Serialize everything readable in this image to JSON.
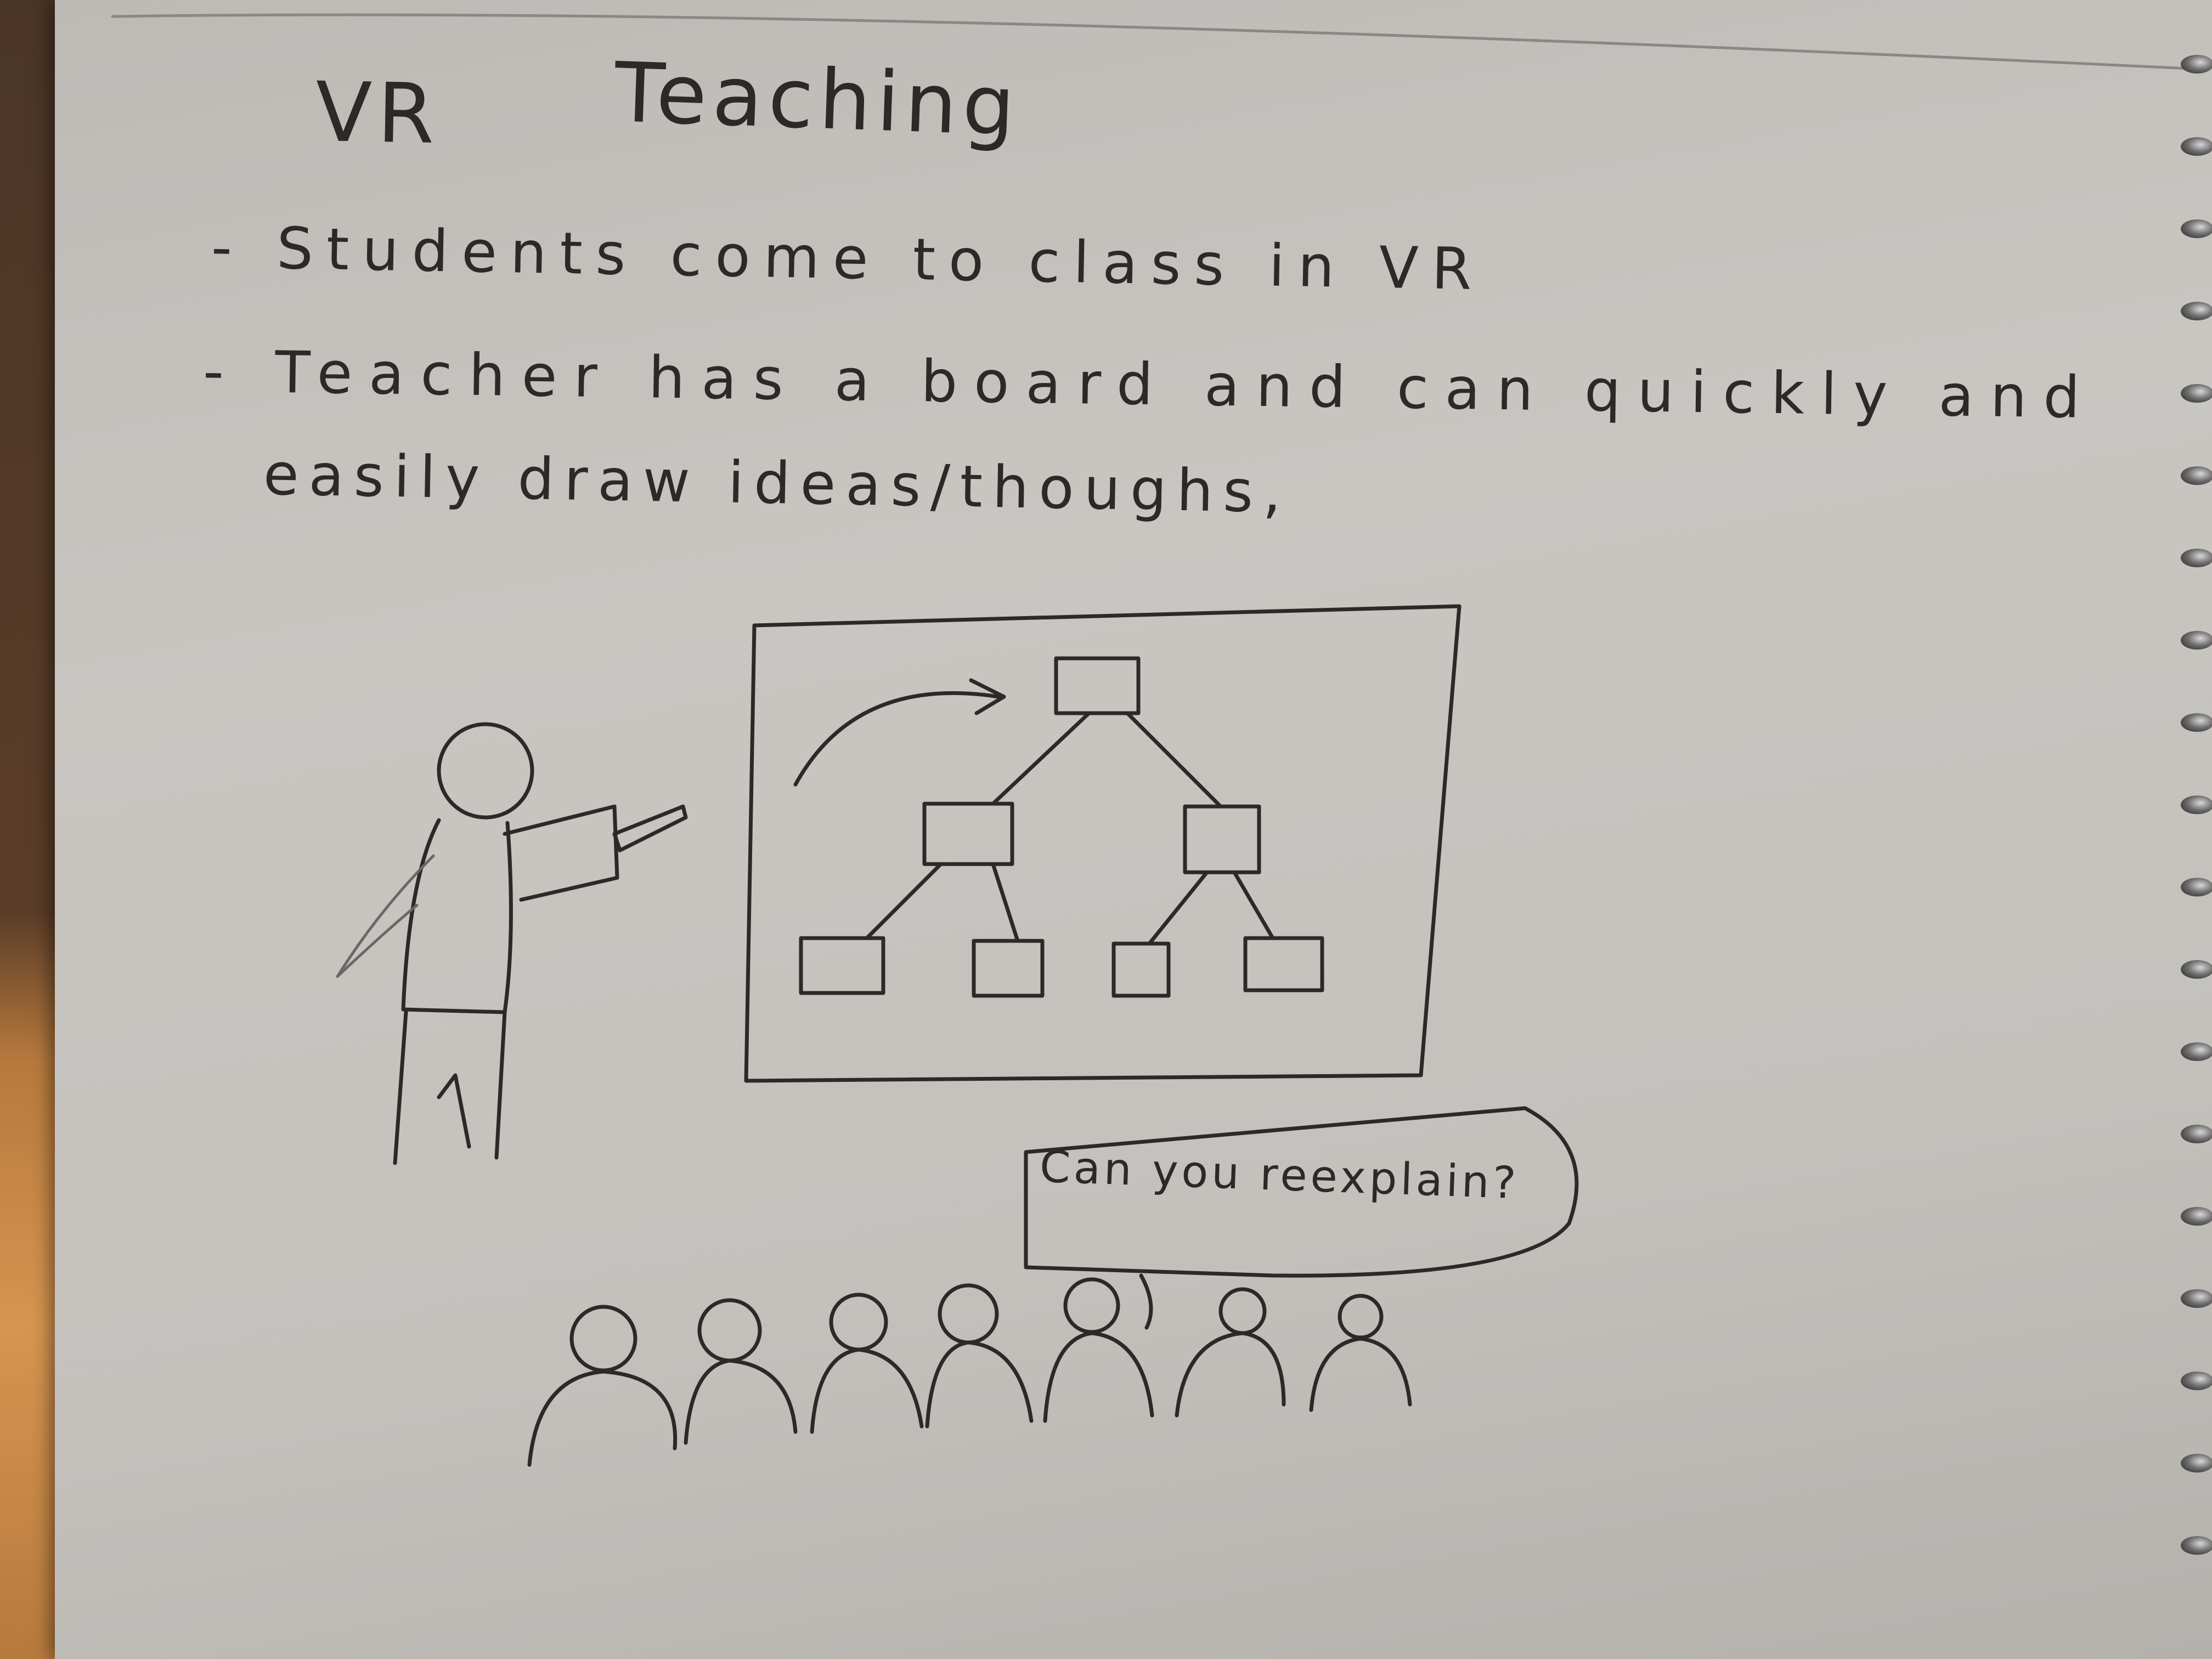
{
  "title": {
    "left": "VR",
    "right": "Teaching"
  },
  "notes": {
    "line1": "- Students come to class in VR",
    "line2": "- Teacher has a board and can quickly and",
    "line3": "easily draw ideas/thoughs,"
  },
  "speech_bubble": {
    "text": "Can you reexplain?"
  },
  "colors": {
    "pencil": "#2c2a28",
    "paper": "#c6c3bf",
    "spiral": "#2a2a2a"
  }
}
